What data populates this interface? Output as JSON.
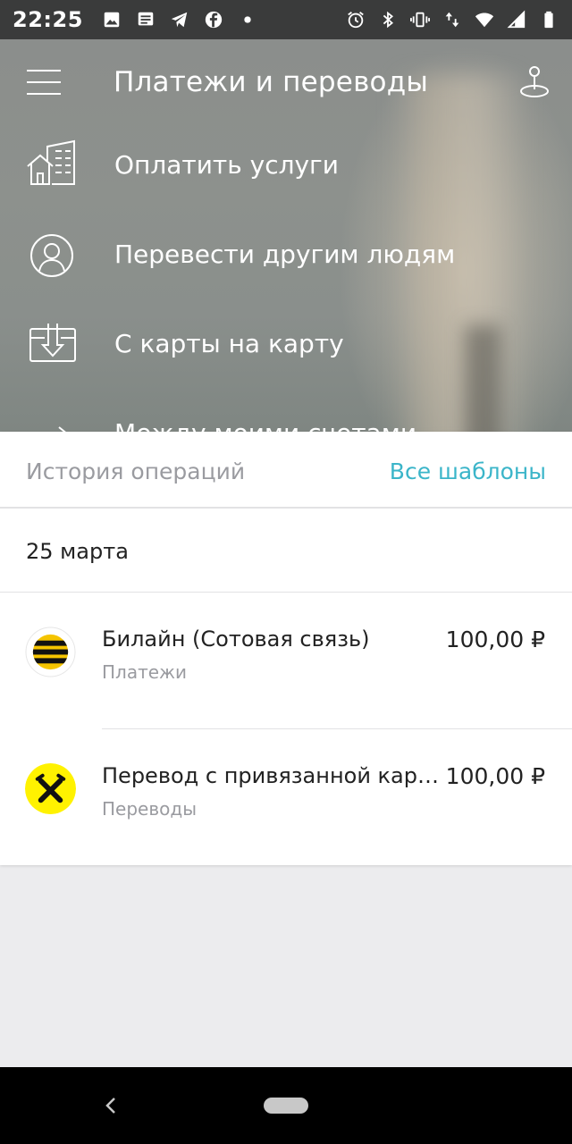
{
  "status_bar": {
    "time": "22:25",
    "left_icons": [
      "image-icon",
      "message-icon",
      "telegram-icon",
      "facebook-icon",
      "dot-icon"
    ],
    "right_icons": [
      "alarm-icon",
      "bluetooth-icon",
      "vibrate-icon",
      "data-arrows-icon",
      "wifi-icon",
      "signal-icon",
      "battery-icon"
    ]
  },
  "header": {
    "title": "Платежи и переводы",
    "menu_icon": "hamburger-icon",
    "map_icon": "map-pin-icon"
  },
  "menu": {
    "items": [
      {
        "label": "Оплатить услуги",
        "icon": "house-building-icon"
      },
      {
        "label": "Перевести другим людям",
        "icon": "person-circle-icon"
      },
      {
        "label": "С карты на карту",
        "icon": "card-download-icon"
      },
      {
        "label": "Между моими счетами",
        "icon": "transfer-arrows-icon"
      }
    ]
  },
  "history": {
    "title": "История операций",
    "all_templates": "Все шаблоны",
    "date": "25 марта",
    "operations": [
      {
        "title": "Билайн (Сотовая связь)",
        "category": "Платежи",
        "amount": "100,00 ₽",
        "logo": "beeline-logo"
      },
      {
        "title": "Перевод с привязанной карты",
        "category": "Переводы",
        "amount": "100,00 ₽",
        "logo": "raiffeisen-logo"
      }
    ]
  },
  "colors": {
    "accent": "#3bb5c9",
    "raiffeisen_yellow": "#fff200",
    "beeline_yellow": "#f5c400"
  }
}
